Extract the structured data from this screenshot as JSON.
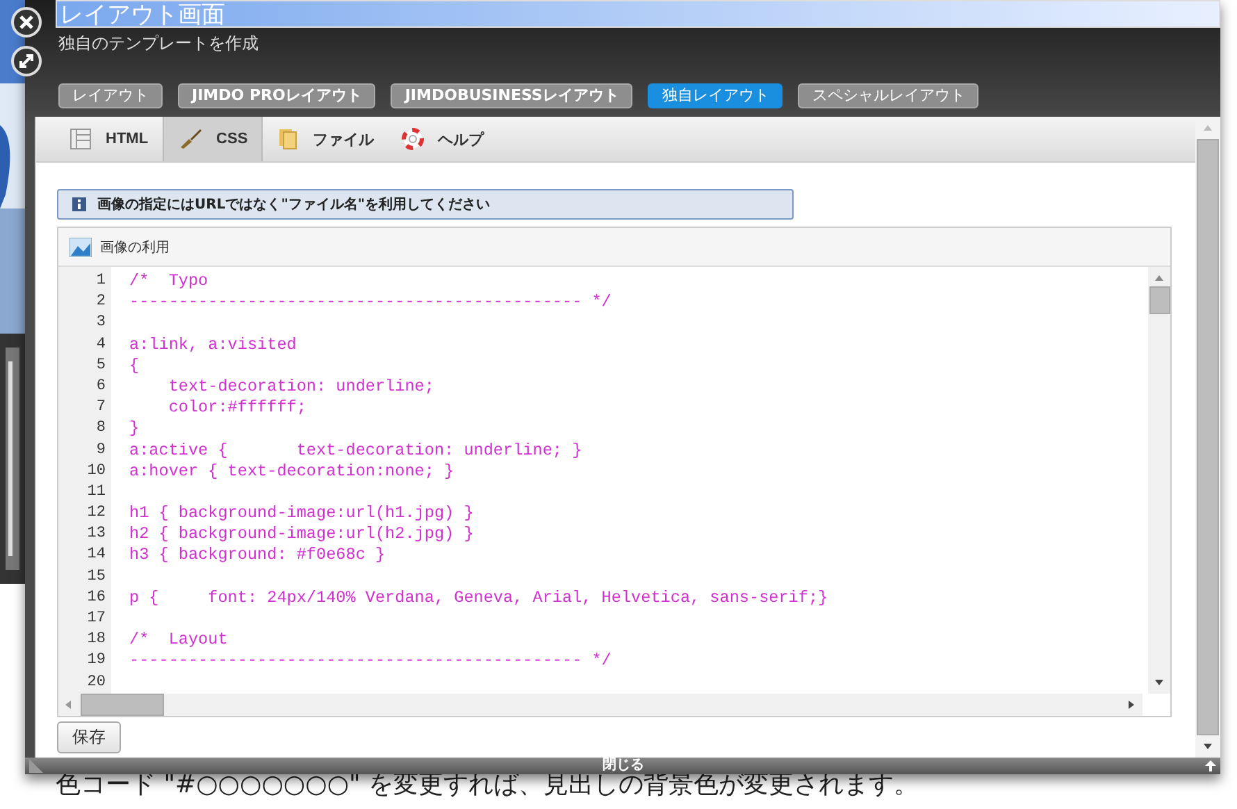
{
  "window": {
    "title": "レイアウト画面",
    "subtitle": "独自のテンプレートを作成",
    "footer": "閉じる"
  },
  "layout_tabs": [
    {
      "label": "レイアウト",
      "selected": false
    },
    {
      "label": "JIMDO PROレイアウト",
      "selected": false
    },
    {
      "label": "JIMDOBUSINESSレイアウト",
      "selected": false
    },
    {
      "label": "独自レイアウト",
      "selected": true
    },
    {
      "label": "スペシャルレイアウト",
      "selected": false
    }
  ],
  "editor_tabs": [
    {
      "label": "HTML",
      "kind": "html",
      "selected": false
    },
    {
      "label": "CSS",
      "kind": "css",
      "selected": true
    },
    {
      "label": "ファイル",
      "kind": "file",
      "selected": false
    },
    {
      "label": "ヘルプ",
      "kind": "help",
      "selected": false
    }
  ],
  "notice": "画像の指定にはURLではなく\"ファイル名\"を利用してください",
  "image_bar": "画像の利用",
  "code_lines": [
    {
      "number": "1",
      "code": "/*  Typo"
    },
    {
      "number": "2",
      "code": "---------------------------------------------- */"
    },
    {
      "number": "3"
    },
    {
      "number": "4",
      "code": "a:link, a:visited"
    },
    {
      "number": "5",
      "code": "{"
    },
    {
      "number": "6",
      "code": "    text-decoration: underline;"
    },
    {
      "number": "7",
      "code": "    color:#ffffff;"
    },
    {
      "number": "8",
      "code": "}"
    },
    {
      "number": "9",
      "code": "a:active {       text-decoration: underline; }"
    },
    {
      "number": "10",
      "code": "a:hover { text-decoration:none; }"
    },
    {
      "number": "11"
    },
    {
      "number": "12",
      "code": "h1 { background-image:url(h1.jpg) }"
    },
    {
      "number": "13",
      "code": "h2 { background-image:url(h2.jpg) }"
    },
    {
      "number": "14",
      "code": "h3 { background: #f0e68c }"
    },
    {
      "number": "15"
    },
    {
      "number": "16",
      "code": "p {     font: 24px/140% Verdana, Geneva, Arial, Helvetica, sans-serif;}"
    },
    {
      "number": "17"
    },
    {
      "number": "18",
      "code": "/*  Layout"
    },
    {
      "number": "19",
      "code": "---------------------------------------------- */"
    },
    {
      "number": "20"
    }
  ],
  "save_button": "保存",
  "page_text": "色コード \"#○○○○○○○\" を変更すれば、見出しの背景色が変更されます。"
}
